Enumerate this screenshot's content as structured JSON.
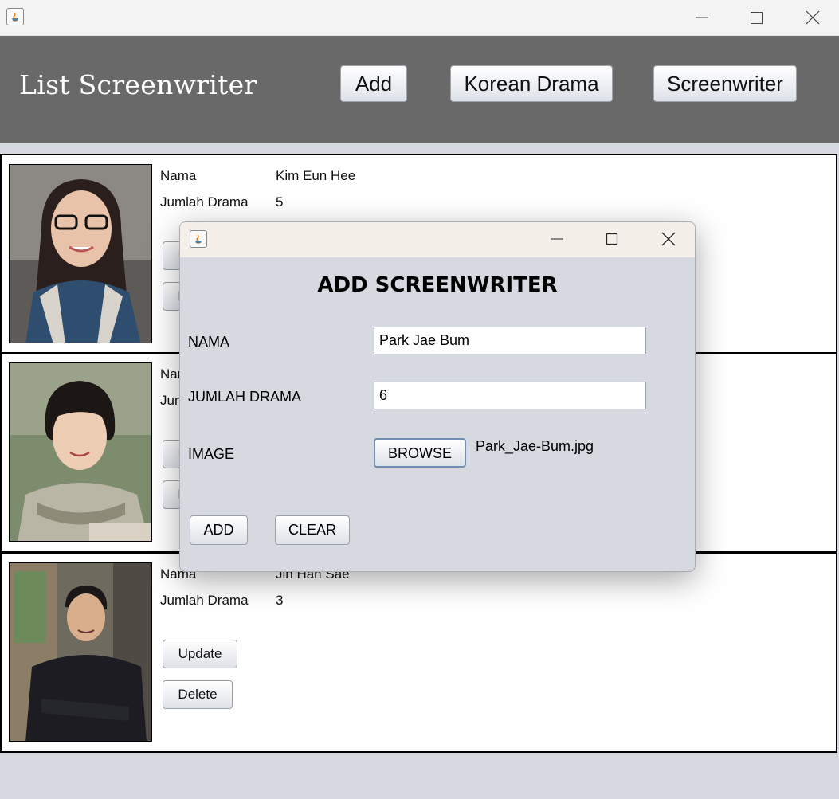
{
  "header": {
    "title": "List Screenwriter",
    "nav": [
      "Add",
      "Korean Drama",
      "Screenwriter"
    ]
  },
  "cards": [
    {
      "nama_label": "Nama",
      "nama": "Kim Eun Hee",
      "jumlah_label": "Jumlah Drama",
      "jumlah": "5",
      "update_label": "Update",
      "delete_label": "Delete"
    },
    {
      "nama_label": "Nama",
      "nama": "",
      "jumlah_label": "Jumlah Drama",
      "jumlah": "",
      "update_label": "Update",
      "delete_label": "Delete"
    },
    {
      "nama_label": "Nama",
      "nama": "Jin Han Sae",
      "jumlah_label": "Jumlah Drama",
      "jumlah": "3",
      "update_label": "Update",
      "delete_label": "Delete"
    }
  ],
  "dialog": {
    "heading": "ADD SCREENWRITER",
    "nama_label": "NAMA",
    "nama_value": "Park Jae Bum",
    "jumlah_label": "JUMLAH DRAMA",
    "jumlah_value": "6",
    "image_label": "IMAGE",
    "browse_label": "BROWSE",
    "file_name": "Park_Jae-Bum.jpg",
    "add_label": "ADD",
    "clear_label": "CLEAR"
  },
  "icons": {
    "app": "java-icon",
    "minimize": "minimize-icon",
    "maximize": "maximize-icon",
    "close": "close-icon"
  },
  "colors": {
    "header_bg": "#696969",
    "body_bg": "#d6d9e0",
    "dialog_titlebar": "#f4efe8"
  }
}
